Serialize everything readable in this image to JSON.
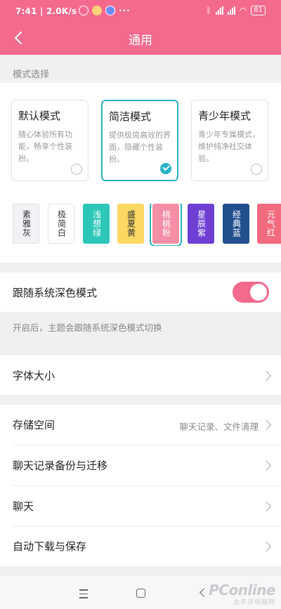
{
  "status_bar": {
    "time": "7:41",
    "net_speed": "2.0K/s",
    "more": "···",
    "network_type": "4G",
    "battery": "81"
  },
  "header": {
    "title": "通用"
  },
  "mode_section": {
    "label": "模式选择",
    "cards": [
      {
        "title": "默认模式",
        "desc": "随心体验所有功能，畅享个性装扮。",
        "selected": false
      },
      {
        "title": "简洁模式",
        "desc": "提供极简高效的界面，隐藏个性装扮。",
        "selected": true
      },
      {
        "title": "青少年模式",
        "desc": "青少年专属模式，维护纯净社交体验。",
        "selected": false
      }
    ],
    "themes": [
      {
        "name": "素雅灰",
        "bg": "#f1f2f5",
        "fg": "#333333",
        "border": "#e0e0e4"
      },
      {
        "name": "极简白",
        "bg": "#ffffff",
        "fg": "#333333",
        "border": "#e0e0e4"
      },
      {
        "name": "浅想绿",
        "bg": "#2cc7b8",
        "fg": "#ffffff",
        "border": "#2cc7b8"
      },
      {
        "name": "盛夏黄",
        "bg": "#fbd862",
        "fg": "#333333",
        "border": "#fbd862"
      },
      {
        "name": "桃桃粉",
        "bg": "#f58fa6",
        "fg": "#ffffff",
        "border": "#f58fa6",
        "selected": true
      },
      {
        "name": "星辰紫",
        "bg": "#6f3fd4",
        "fg": "#ffffff",
        "border": "#6f3fd4"
      },
      {
        "name": "经典蓝",
        "bg": "#234f8f",
        "fg": "#ffffff",
        "border": "#234f8f"
      },
      {
        "name": "元气红",
        "bg": "#f26a7d",
        "fg": "#ffffff",
        "border": "#f26a7d"
      }
    ]
  },
  "dark_mode": {
    "label": "跟随系统深色模式",
    "enabled": true,
    "hint": "开启后，主题会跟随系统深色模式切换"
  },
  "font_size": {
    "label": "字体大小"
  },
  "menu": [
    {
      "label": "存储空间",
      "value": "聊天记录、文件清理"
    },
    {
      "label": "聊天记录备份与迁移",
      "value": ""
    },
    {
      "label": "聊天",
      "value": ""
    },
    {
      "label": "自动下载与保存",
      "value": ""
    }
  ],
  "watermark": {
    "brand": "PConline",
    "sub": "太平洋电脑网"
  },
  "colors": {
    "accent": "#f36a8d",
    "selected": "#24b3c6"
  }
}
